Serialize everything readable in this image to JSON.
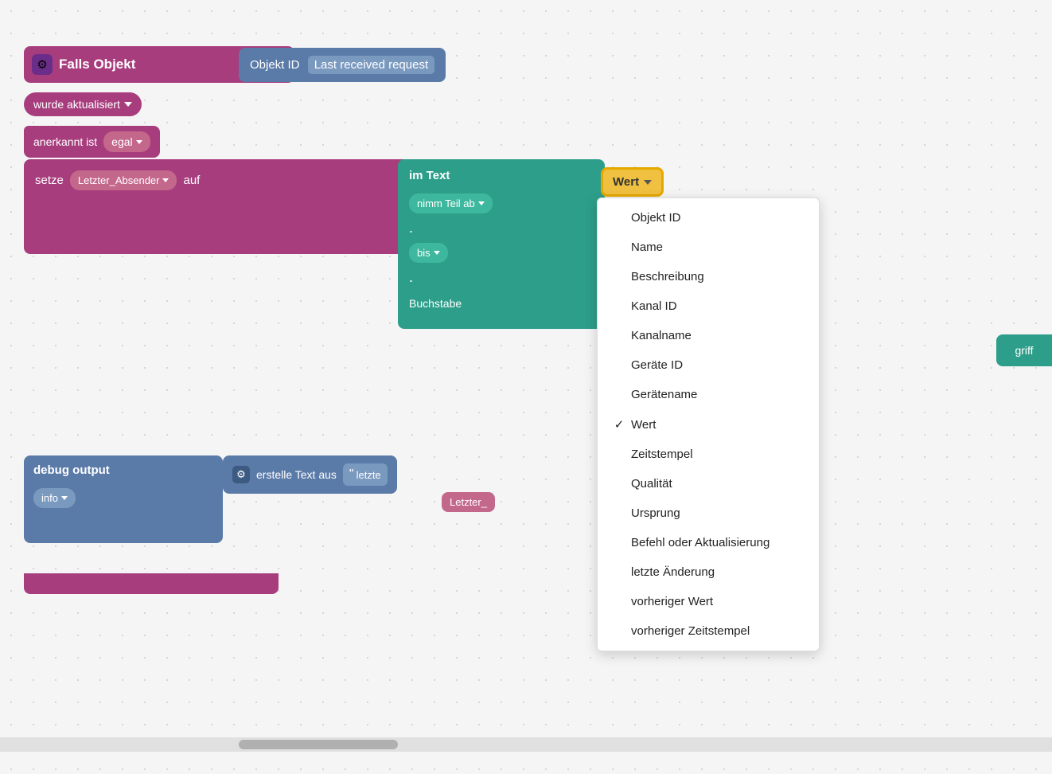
{
  "canvas": {
    "bg_color": "#f5f5f5"
  },
  "falls_block": {
    "title": "Falls Objekt",
    "gear_icon": "⚙",
    "objekt_id_label": "Objekt ID",
    "objekt_id_value": "Last received request",
    "wurde_label": "wurde aktualisiert",
    "anerkannt_label": "anerkannt ist",
    "egal_label": "egal"
  },
  "setze_block": {
    "label": "setze",
    "variable": "Letzter_Absender",
    "auf_label": "auf",
    "im_text_label": "im Text",
    "nimm_teil_label": "nimm Teil ab",
    "bis_label": "bis",
    "buchstabe_label": "Buchstabe"
  },
  "wert_dropdown": {
    "button_label": "Wert",
    "items": [
      {
        "label": "Objekt ID",
        "checked": false
      },
      {
        "label": "Name",
        "checked": false
      },
      {
        "label": "Beschreibung",
        "checked": false
      },
      {
        "label": "Kanal ID",
        "checked": false
      },
      {
        "label": "Kanalname",
        "checked": false
      },
      {
        "label": "Geräte ID",
        "checked": false
      },
      {
        "label": "Gerätename",
        "checked": false
      },
      {
        "label": "Wert",
        "checked": true
      },
      {
        "label": "Zeitstempel",
        "checked": false
      },
      {
        "label": "Qualität",
        "checked": false
      },
      {
        "label": "Ursprung",
        "checked": false
      },
      {
        "label": "Befehl oder Aktualisierung",
        "checked": false
      },
      {
        "label": "letzte Änderung",
        "checked": false
      },
      {
        "label": "vorheriger Wert",
        "checked": false
      },
      {
        "label": "vorheriger Zeitstempel",
        "checked": false
      }
    ]
  },
  "debug_block": {
    "title": "debug output",
    "info_label": "info",
    "gear_icon": "⚙",
    "erstelle_label": "erstelle Text aus",
    "letzt_label": "letzte",
    "letzter_label": "Letzter_"
  },
  "griff_label": "griff"
}
